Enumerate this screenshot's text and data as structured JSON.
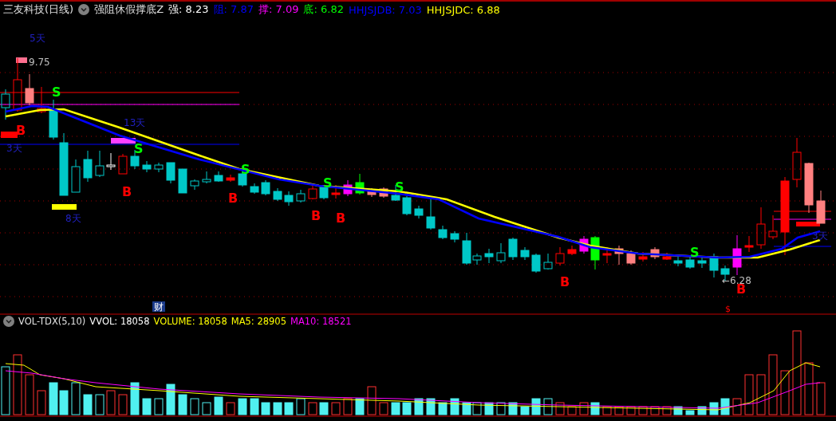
{
  "header": {
    "stock_name": "三友科技(日线)",
    "indicator": "强阻休假撑底Z",
    "values": [
      {
        "label": "强: 8.23",
        "color": "#ffffff"
      },
      {
        "label": "阻: 7.87",
        "color": "#0000ff"
      },
      {
        "label": "撑: 7.09",
        "color": "#ff00ff"
      },
      {
        "label": "底: 6.82",
        "color": "#00ff00"
      },
      {
        "label": "HHJSJDB: 7.03",
        "color": "#0000ff"
      },
      {
        "label": "HHJSJDC: 6.88",
        "color": "#ffff00"
      }
    ]
  },
  "markers": [
    {
      "kind": "days",
      "text": "5天"
    },
    {
      "kind": "price",
      "text": "9.75"
    },
    {
      "kind": "sell",
      "text": "S"
    },
    {
      "kind": "buy",
      "text": "B"
    },
    {
      "kind": "days",
      "text": "3天"
    },
    {
      "kind": "days",
      "text": "13天"
    },
    {
      "kind": "sell",
      "text": "S"
    },
    {
      "kind": "buy",
      "text": "B"
    },
    {
      "kind": "days",
      "text": "8天"
    },
    {
      "kind": "buy",
      "text": "B"
    },
    {
      "kind": "sell",
      "text": "S"
    },
    {
      "kind": "sell",
      "text": "S"
    },
    {
      "kind": "buy",
      "text": "B"
    },
    {
      "kind": "buy",
      "text": "B"
    },
    {
      "kind": "sell",
      "text": "S"
    },
    {
      "kind": "buy",
      "text": "B"
    },
    {
      "kind": "sell",
      "text": "S"
    },
    {
      "kind": "price",
      "text": "←6.28"
    },
    {
      "kind": "buy",
      "text": "B"
    },
    {
      "kind": "dollar",
      "text": "$"
    },
    {
      "kind": "days",
      "text": "3天"
    },
    {
      "kind": "badge",
      "text": "财"
    }
  ],
  "volume_header": {
    "title": "VOL-TDX(5,10)",
    "values": [
      {
        "label": "VVOL: 18058",
        "color": "#ffffff"
      },
      {
        "label": "VOLUME: 18058",
        "color": "#ffff00"
      },
      {
        "label": "MA5: 28905",
        "color": "#ffff00"
      },
      {
        "label": "MA10: 18521",
        "color": "#ff00ff"
      }
    ]
  }
}
